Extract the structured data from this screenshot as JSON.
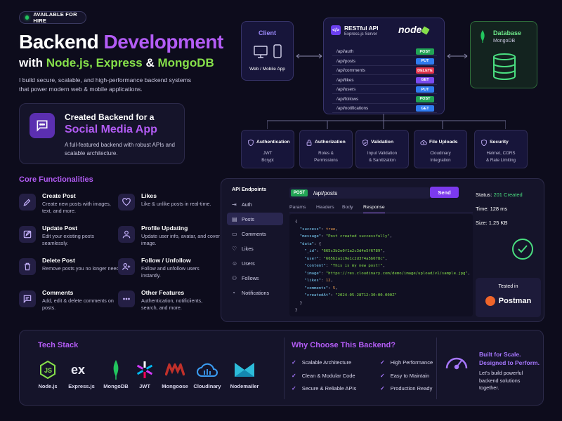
{
  "badge": "AVAILABLE FOR HIRE",
  "hero": {
    "title_a": "Backend",
    "title_b": "Development",
    "sub_a": "with",
    "sub_b": "Node.js, Express",
    "sub_c": "&",
    "sub_d": "MongoDB",
    "intro": "I build secure, scalable, and high-performance backend systems that power modern web & mobile applications."
  },
  "project": {
    "line1": "Created Backend for a",
    "line2": "Social Media App",
    "desc": "A full-featured backend with robust APIs and scalable architecture."
  },
  "core": {
    "title": "Core Functionalities",
    "items": [
      {
        "title": "Create Post",
        "desc": "Create new posts with images, text, and more."
      },
      {
        "title": "Likes",
        "desc": "Like & unlike posts in real-time."
      },
      {
        "title": "Update Post",
        "desc": "Edit your existing posts seamlessly."
      },
      {
        "title": "Profile Updating",
        "desc": "Update user info, avatar, and cover image."
      },
      {
        "title": "Delete Post",
        "desc": "Remove posts you no longer need."
      },
      {
        "title": "Follow / Unfollow",
        "desc": "Follow and unfollow users instantly."
      },
      {
        "title": "Comments",
        "desc": "Add, edit & delete comments on posts."
      },
      {
        "title": "Other Features",
        "desc": "Authentication, notificiients, search, and more."
      }
    ]
  },
  "client": {
    "title": "Client",
    "label": "Web / Mobile App"
  },
  "api": {
    "title": "RESTful API",
    "sub": "Express.js Server",
    "logo": "node",
    "routes": [
      {
        "path": "/api/auth",
        "method": "POST",
        "color": "#22a455"
      },
      {
        "path": "/api/posts",
        "method": "PUT",
        "color": "#2f7cf0"
      },
      {
        "path": "/api/comments",
        "method": "DELETE",
        "color": "#e0334a"
      },
      {
        "path": "/api/likes",
        "method": "GET",
        "color": "#7b4cf0"
      },
      {
        "path": "/api/users",
        "method": "PUT",
        "color": "#2f7cf0"
      },
      {
        "path": "/api/follows",
        "method": "POST",
        "color": "#22a455"
      },
      {
        "path": "/api/notifications",
        "method": "GET",
        "color": "#2f7cf0"
      }
    ]
  },
  "db": {
    "title": "Database",
    "sub": "MongoDB"
  },
  "middleware": [
    {
      "title": "Authentication",
      "l1": "JWT",
      "l2": "Bcrypt"
    },
    {
      "title": "Authorization",
      "l1": "Roles &",
      "l2": "Permissions"
    },
    {
      "title": "Validation",
      "l1": "Input Validation",
      "l2": "& Sanitization"
    },
    {
      "title": "File Uploads",
      "l1": "Cloudinary",
      "l2": "Integration"
    },
    {
      "title": "Security",
      "l1": "Helmet, CORS",
      "l2": "& Rate Limiting"
    }
  ],
  "playground": {
    "sidebar_title": "API Endpoints",
    "endpoints": [
      "Auth",
      "Posts",
      "Comments",
      "Likes",
      "Users",
      "Follows",
      "Notifications"
    ],
    "method": "POST",
    "url": "/api/posts",
    "send": "Send",
    "tabs": [
      "Params",
      "Headers",
      "Body",
      "Response"
    ],
    "status_label": "Status:",
    "status_value": "201 Created",
    "time_label": "Time:",
    "time_value": "128 ms",
    "size_label": "Size:",
    "size_value": "1.25 KB",
    "tested_in": "Tested in",
    "tool": "Postman"
  },
  "tech": {
    "title": "Tech Stack",
    "items": [
      "Node.js",
      "Express.js",
      "MongoDB",
      "JWT",
      "Mongoose",
      "Cloudinary",
      "Nodemailer"
    ]
  },
  "why": {
    "title": "Why Choose This Backend?",
    "items": [
      "Scalable Architecture",
      "High Performance",
      "Clean & Modular Code",
      "Easy to Maintain",
      "Secure & Reliable APIs",
      "Production Ready"
    ]
  },
  "cta": {
    "l1": "Built for Scale.",
    "l2": "Designed to Perform.",
    "text": "Let's build powerful backend solutions together."
  },
  "colors": {
    "accent": "#b35cf5",
    "green": "#86e04a",
    "bg": "#0d0c1c"
  }
}
